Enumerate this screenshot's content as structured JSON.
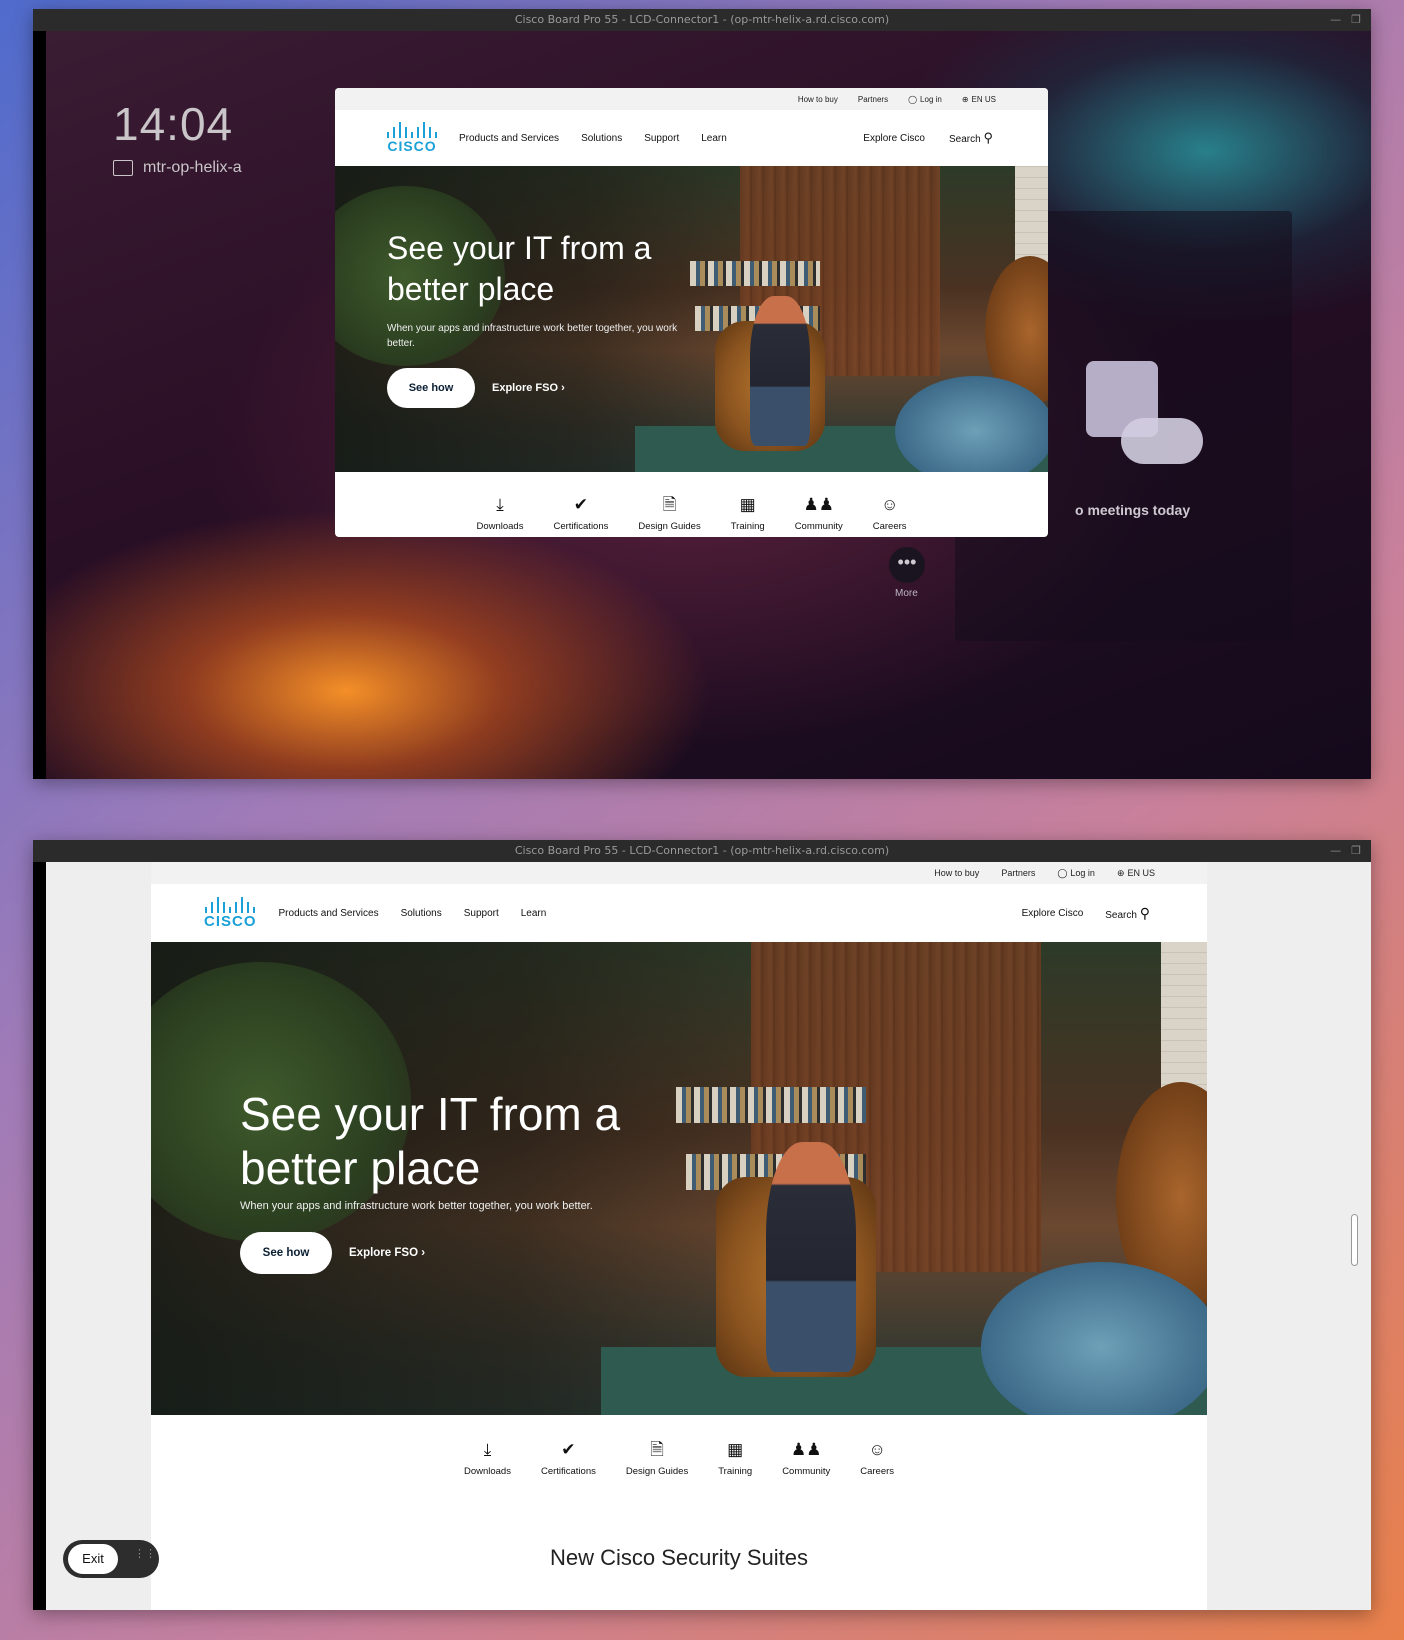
{
  "window": {
    "title": "Cisco Board Pro 55 - LCD-Connector1 - (op-mtr-helix-a.rd.cisco.com)",
    "controls": [
      "minimize-icon",
      "restore-icon"
    ]
  },
  "device": {
    "time": "14:04",
    "name": "mtr-op-helix-a",
    "meetings_text": "o meetings today",
    "more_label": "More"
  },
  "site": {
    "utility_links": [
      "How to buy",
      "Partners",
      "Log in",
      "EN US"
    ],
    "logo_text": "CISCO",
    "nav": [
      "Products and Services",
      "Solutions",
      "Support",
      "Learn"
    ],
    "explore": "Explore Cisco",
    "search": "Search",
    "hero": {
      "title_line1": "See your IT from a",
      "title_line2": "better place",
      "subtitle": "When your apps and infrastructure work better together, you work better.",
      "primary_cta": "See how",
      "secondary_cta": "Explore FSO"
    },
    "quick_links": [
      "Downloads",
      "Certifications",
      "Design Guides",
      "Training",
      "Community",
      "Careers"
    ],
    "section_title": "New Cisco Security Suites"
  },
  "controls": {
    "exit_label": "Exit"
  },
  "colors": {
    "cisco_blue": "#1ba0d7",
    "cta_text": "#0b1f33"
  }
}
